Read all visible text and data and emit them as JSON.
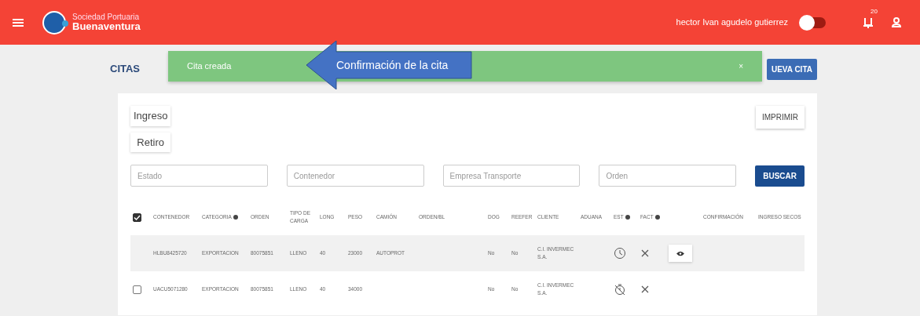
{
  "header": {
    "brand_line_1": "Sociedad Portuaria",
    "brand_line_2": "Buenaventura",
    "user_name": "hector Ivan agudelo gutierrez",
    "toggle_on": false,
    "notification_count": "20"
  },
  "page": {
    "title": "CITAS",
    "new_button": "UEVA CITA"
  },
  "toast": {
    "message": "Cita creada",
    "close": "×"
  },
  "callout": {
    "text": "Confirmación de la cita"
  },
  "tabs": [
    {
      "label": "Ingreso",
      "selected": false
    },
    {
      "label": "Retiro",
      "selected": false
    }
  ],
  "print_button": "IMPRIMIR",
  "filters": [
    {
      "placeholder": "Estado"
    },
    {
      "placeholder": "Contenedor"
    },
    {
      "placeholder": "Empresa Transporte"
    },
    {
      "placeholder": "Orden"
    }
  ],
  "search_button": "BUSCAR",
  "table": {
    "all_checked": true,
    "columns": [
      {
        "label": "CONTENEDOR",
        "info": false
      },
      {
        "label": "CATEGORIA",
        "info": true
      },
      {
        "label": "ORDEN",
        "info": false
      },
      {
        "label": "TIPO DE CARGA",
        "info": false
      },
      {
        "label": "LONG",
        "info": false
      },
      {
        "label": "PESO",
        "info": false
      },
      {
        "label": "CAMIÓN",
        "info": false
      },
      {
        "label": "ORDEN/BL",
        "info": false
      },
      {
        "label": "DOG",
        "info": false
      },
      {
        "label": "REEFER",
        "info": false
      },
      {
        "label": "CLIENTE",
        "info": false
      },
      {
        "label": "ADUANA",
        "info": false
      },
      {
        "label": "EST",
        "info": true
      },
      {
        "label": "FACT",
        "info": true
      },
      {
        "info": false
      },
      {
        "label": "CONFIRMACIÓN",
        "info": false
      },
      {
        "label": "INGRESO SECOS",
        "info": false
      }
    ],
    "rows": [
      {
        "selected": true,
        "cells": [
          "HLBU8425720",
          "EXPORTACION",
          "80075851",
          "LLENO",
          "40",
          "23000",
          "AUTOPROT",
          "",
          "No",
          "No",
          "C.I. INVERMEC S.A."
        ],
        "est": {
          "kind": "clock"
        },
        "fact": {
          "kind": "x"
        },
        "view_button": true
      },
      {
        "selected": false,
        "checked": false,
        "cells": [
          "UACU5071280",
          "EXPORTACION",
          "80075851",
          "LLENO",
          "40",
          "34000",
          "",
          "",
          "No",
          "No",
          "C.I. INVERMEC S.A."
        ],
        "est": {
          "kind": "timer-off"
        },
        "fact": {
          "kind": "x"
        },
        "view_button": false
      }
    ]
  }
}
